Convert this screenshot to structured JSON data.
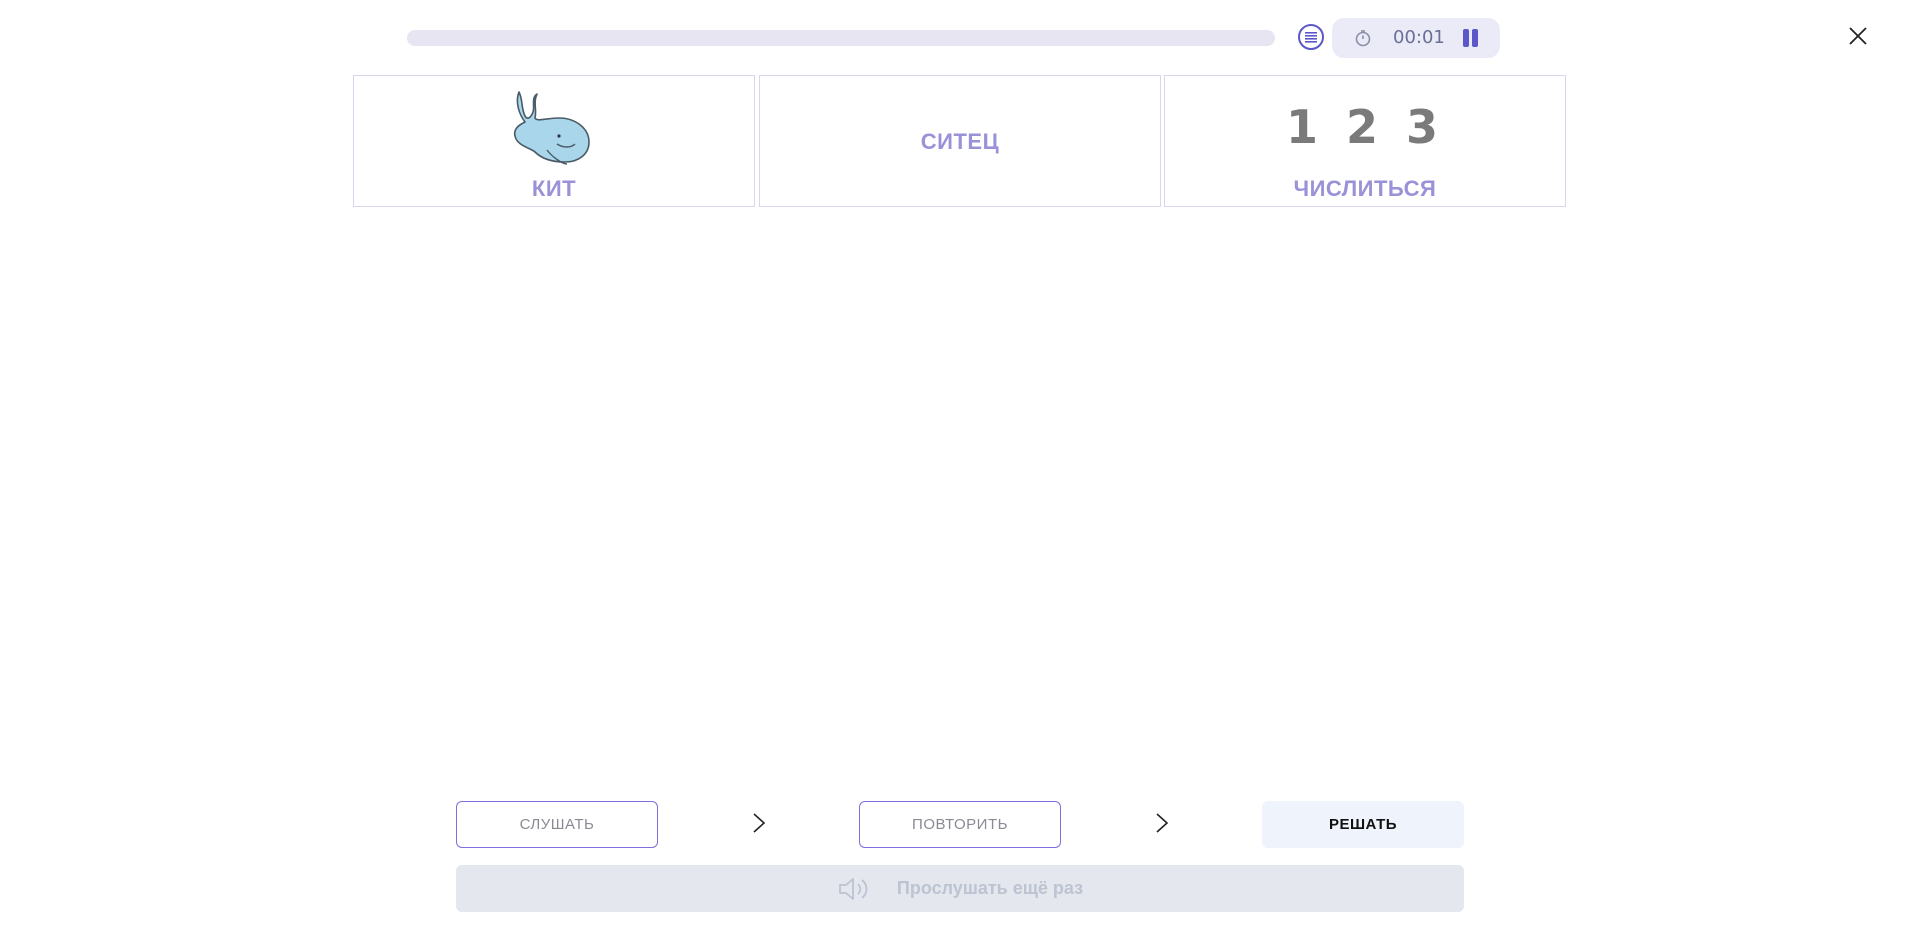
{
  "header": {
    "progress_fraction": 0.0,
    "timer": "00:01",
    "icons": {
      "list": "list-icon",
      "stopwatch": "stopwatch-icon",
      "pause": "pause-icon",
      "close": "close-icon"
    }
  },
  "cards": [
    {
      "label": "КИТ",
      "picture": "whale-icon"
    },
    {
      "label": "СИТЕЦ"
    },
    {
      "label": "ЧИСЛИТЬСЯ",
      "picture_text": "1 2 3"
    }
  ],
  "steps": {
    "listen_label": "СЛУШАТЬ",
    "repeat_label": "ПОВТОРИТЬ",
    "solve_label": "РЕШАТЬ"
  },
  "replay": {
    "label": "Прослушать ещё раз",
    "icon": "speaker-icon"
  },
  "colors": {
    "accent": "#5b57c8",
    "card_text": "#9a92d8",
    "border": "#d8d6ee",
    "solve_bg": "#eef3fc",
    "replay_bg": "#e4e7ee"
  }
}
